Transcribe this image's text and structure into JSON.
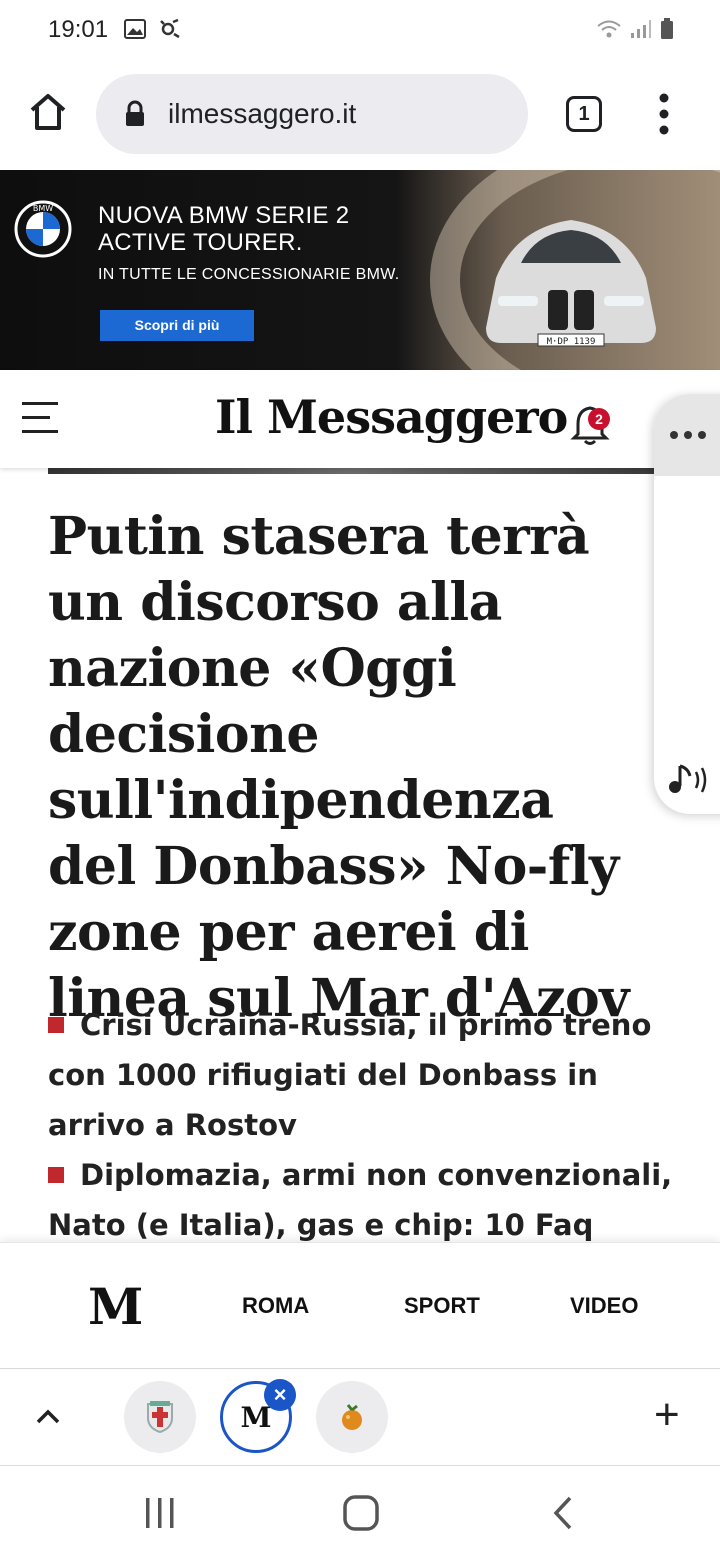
{
  "status_bar": {
    "time": "19:01"
  },
  "browser": {
    "url": "ilmessaggero.it",
    "tab_count": "1"
  },
  "ad": {
    "title_line1": "NUOVA BMW SERIE 2",
    "title_line2": "ACTIVE TOURER.",
    "subtitle": "IN TUTTE LE CONCESSIONARIE BMW.",
    "cta": "Scopri di più",
    "logo_text": "BMW",
    "plate": "M·DP 1139",
    "brand_color": "#1c69d4"
  },
  "site": {
    "masthead": "Il Messaggero",
    "notification_count": "2",
    "headline": "Putin stasera terrà un discorso alla nazione «Oggi decisione sull'indipendenza del Donbass» No-fly zone per aerei di linea sul Mar d'Azov",
    "related": [
      {
        "text": "Crisi Ucraina-Russia, il primo treno con 1000 rifiugiati del Donbass in arrivo a Rostov"
      },
      {
        "text": "Diplomazia, armi non convenzionali, Nato (e Italia), gas e chip: 10 Faq"
      }
    ],
    "bullet_color": "#c0282d",
    "nav": {
      "logo": "M",
      "items": [
        "ROMA",
        "SPORT",
        "VIDEO"
      ]
    }
  },
  "tab_strip": {
    "active_tab_logo": "M",
    "close_symbol": "×",
    "add_symbol": "+",
    "accent_color": "#1a56c8"
  }
}
